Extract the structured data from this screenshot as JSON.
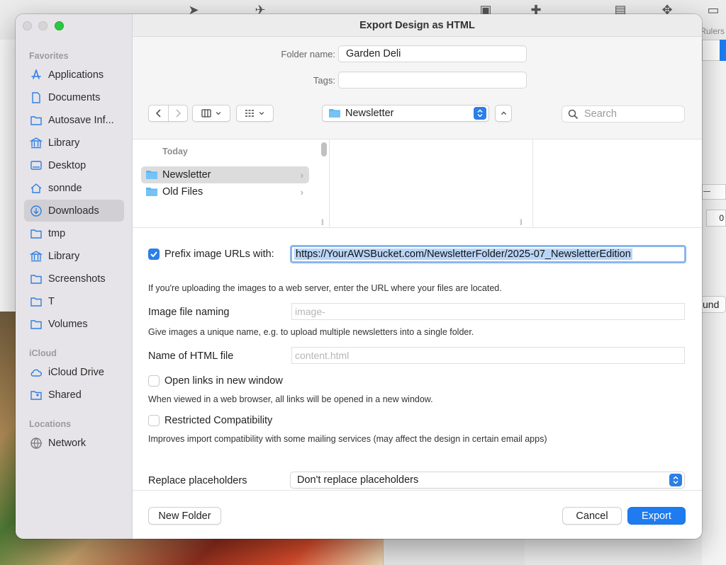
{
  "dialog": {
    "title": "Export Design as HTML"
  },
  "background": {
    "rulers_label": "Rulers",
    "field_value": "0",
    "button_fragment": "und"
  },
  "sidebar": {
    "sections": [
      {
        "title": "Favorites",
        "items": [
          {
            "label": "Applications",
            "icon": "applications-icon"
          },
          {
            "label": "Documents",
            "icon": "document-icon"
          },
          {
            "label": "Autosave Inf...",
            "icon": "folder-icon"
          },
          {
            "label": "Library",
            "icon": "library-icon"
          },
          {
            "label": "Desktop",
            "icon": "desktop-icon"
          },
          {
            "label": "sonnde",
            "icon": "home-icon"
          },
          {
            "label": "Downloads",
            "icon": "downloads-icon"
          },
          {
            "label": "tmp",
            "icon": "folder-icon"
          },
          {
            "label": "Library",
            "icon": "library-icon"
          },
          {
            "label": "Screenshots",
            "icon": "folder-icon"
          },
          {
            "label": "T",
            "icon": "folder-icon"
          },
          {
            "label": "Volumes",
            "icon": "folder-icon"
          }
        ]
      },
      {
        "title": "iCloud",
        "items": [
          {
            "label": "iCloud Drive",
            "icon": "cloud-icon"
          },
          {
            "label": "Shared",
            "icon": "shared-folder-icon"
          }
        ]
      },
      {
        "title": "Locations",
        "items": [
          {
            "label": "Network",
            "icon": "globe-icon"
          }
        ]
      }
    ],
    "selected": "Downloads"
  },
  "save": {
    "folder_name_label": "Folder name:",
    "folder_name_value": "Garden Deli",
    "tags_label": "Tags:",
    "tags_value": ""
  },
  "toolbar": {
    "location": "Newsletter",
    "search_placeholder": "Search"
  },
  "browser": {
    "group_header": "Today",
    "rows": [
      {
        "label": "Newsletter",
        "selected": true
      },
      {
        "label": "Old Files",
        "selected": false
      }
    ]
  },
  "options": {
    "prefix": {
      "label": "Prefix image URLs with:",
      "checked": true,
      "value": "https://YourAWSBucket.com/NewsletterFolder/2025-07_NewsletterEdition",
      "help": "If you're uploading the images to a web server, enter the URL where your files are located."
    },
    "image_naming": {
      "label": "Image file naming",
      "placeholder": "image-",
      "help": "Give images a unique name, e.g. to upload multiple newsletters into a single folder."
    },
    "html_name": {
      "label": "Name of HTML file",
      "placeholder": "content.html"
    },
    "open_links": {
      "label": "Open links in new window",
      "checked": false,
      "help": "When viewed in a web browser, all links will be opened in a new window."
    },
    "restricted": {
      "label": "Restricted Compatibility",
      "checked": false,
      "help": "Improves import compatibility with some mailing services (may affect the design in certain email apps)"
    },
    "placeholders": {
      "label": "Replace placeholders",
      "value": "Don't replace placeholders"
    }
  },
  "footer": {
    "new_folder": "New Folder",
    "cancel": "Cancel",
    "export": "Export"
  },
  "colors": {
    "accent": "#1f7cf0",
    "sidebar_bg": "#e6e4e8",
    "selection": "#b8d5f7"
  }
}
